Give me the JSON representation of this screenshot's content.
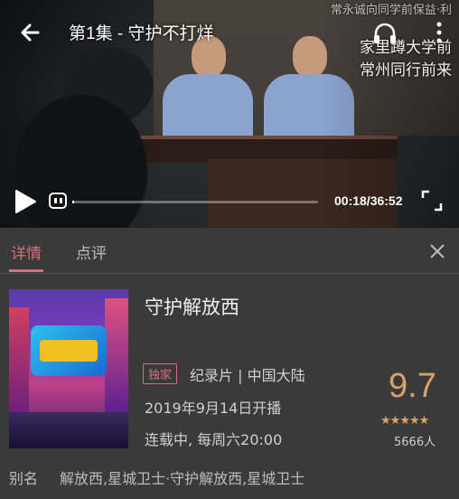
{
  "player": {
    "title": "第1集 - 守护不打烊",
    "overlay_lines": [
      "常永诚向同学前保益·利",
      "家里蹲大学前",
      "常州同行前来"
    ],
    "current_time": "00:18",
    "duration": "36:52",
    "time_display": "00:18/36:52",
    "progress": 0.008
  },
  "tabs": [
    {
      "label": "详情",
      "active": true
    },
    {
      "label": "点评",
      "active": false
    }
  ],
  "detail": {
    "show_name": "守护解放西",
    "badge": "独家",
    "genre": "纪录片 | 中国大陆",
    "premiere": "2019年9月14日开播",
    "schedule": "连载中, 每周六20:00",
    "score": "9.7",
    "stars": 5,
    "raters": "5666人",
    "alias_label": "别名",
    "alias_value": "解放西,星城卫士·守护解放西,星城卫士"
  },
  "colors": {
    "accent": "#d4707e",
    "score": "#d8a36a",
    "background": "#3a3a3a"
  },
  "icons": [
    "back-arrow-icon",
    "headphone-icon",
    "more-vertical-icon",
    "play-icon",
    "danmu-icon",
    "fullscreen-icon",
    "close-icon",
    "star-icon"
  ]
}
